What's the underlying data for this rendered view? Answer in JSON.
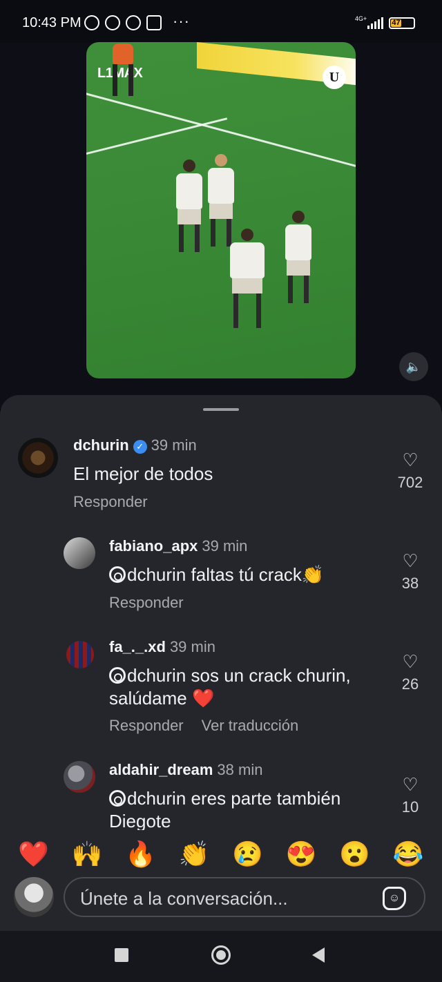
{
  "status_bar": {
    "time": "10:43 PM",
    "dots": "···",
    "network": "4G+",
    "battery": "47"
  },
  "video": {
    "watermark": "L1MAX",
    "club_badge": "U",
    "mute_icon": "speaker-icon"
  },
  "comments": [
    {
      "username": "dchurin",
      "verified": true,
      "time": "39 min",
      "text": "El mejor de todos",
      "mention": "",
      "actions": [
        "Responder"
      ],
      "likes": "702"
    },
    {
      "username": "fabiano_apx",
      "verified": false,
      "time": "39 min",
      "mention": "dchurin",
      "text": " faltas tú crack👏",
      "actions": [
        "Responder"
      ],
      "likes": "38"
    },
    {
      "username": "fa_._.xd",
      "verified": false,
      "time": "39 min",
      "mention": "dchurin",
      "text": " sos un crack churin, salúdame ❤️",
      "actions": [
        "Responder",
        "Ver traducción"
      ],
      "likes": "26"
    },
    {
      "username": "aldahir_dream",
      "verified": false,
      "time": "38 min",
      "mention": "dchurin",
      "text": " eres parte también Diegote",
      "actions": [],
      "likes": "10"
    }
  ],
  "emoji_bar": [
    "❤️",
    "🙌",
    "🔥",
    "👏",
    "😢",
    "😍",
    "😮",
    "😂"
  ],
  "composer": {
    "placeholder": "Únete a la conversación..."
  },
  "colors": {
    "sheet_bg": "#24262c",
    "verified": "#3b8ef0",
    "battery": "#f5b82e"
  }
}
